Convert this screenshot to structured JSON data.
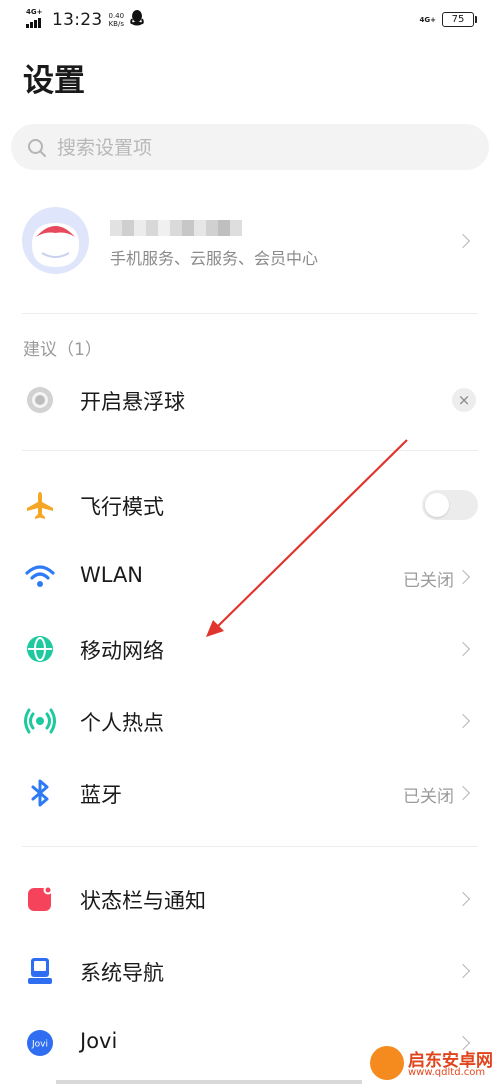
{
  "status_bar": {
    "network_left": "4G+",
    "time": "13:23",
    "speed_value": "0.40",
    "speed_unit": "KB/s",
    "network_right": "4G+",
    "battery": "75"
  },
  "page_title": "设置",
  "search": {
    "placeholder": "搜索设置项"
  },
  "account": {
    "subtitle": "手机服务、云服务、会员中心"
  },
  "suggestions": {
    "label": "建议（1）",
    "items": [
      {
        "label": "开启悬浮球",
        "icon": "floating-ball-icon"
      }
    ]
  },
  "network_items": [
    {
      "label": "飞行模式",
      "icon": "airplane-icon",
      "color": "#f5a623",
      "toggle": false
    },
    {
      "label": "WLAN",
      "icon": "wifi-icon",
      "color": "#2f7bf5",
      "value": "已关闭"
    },
    {
      "label": "移动网络",
      "icon": "globe-icon",
      "color": "#1ec9a0"
    },
    {
      "label": "个人热点",
      "icon": "hotspot-icon",
      "color": "#1ec9a0"
    },
    {
      "label": "蓝牙",
      "icon": "bluetooth-icon",
      "color": "#2f7bf5",
      "value": "已关闭"
    }
  ],
  "system_items": [
    {
      "label": "状态栏与通知",
      "icon": "notification-icon",
      "color": "#f5435b"
    },
    {
      "label": "系统导航",
      "icon": "navigation-icon",
      "color": "#2f6ef0"
    },
    {
      "label": "Jovi",
      "icon": "jovi-icon",
      "color": "#2f6ef0",
      "icon_text": "Jovi"
    }
  ],
  "watermark": {
    "title": "启东安卓网",
    "url": "www.qdltd.com"
  },
  "annotation": {
    "color": "#e0342c"
  }
}
